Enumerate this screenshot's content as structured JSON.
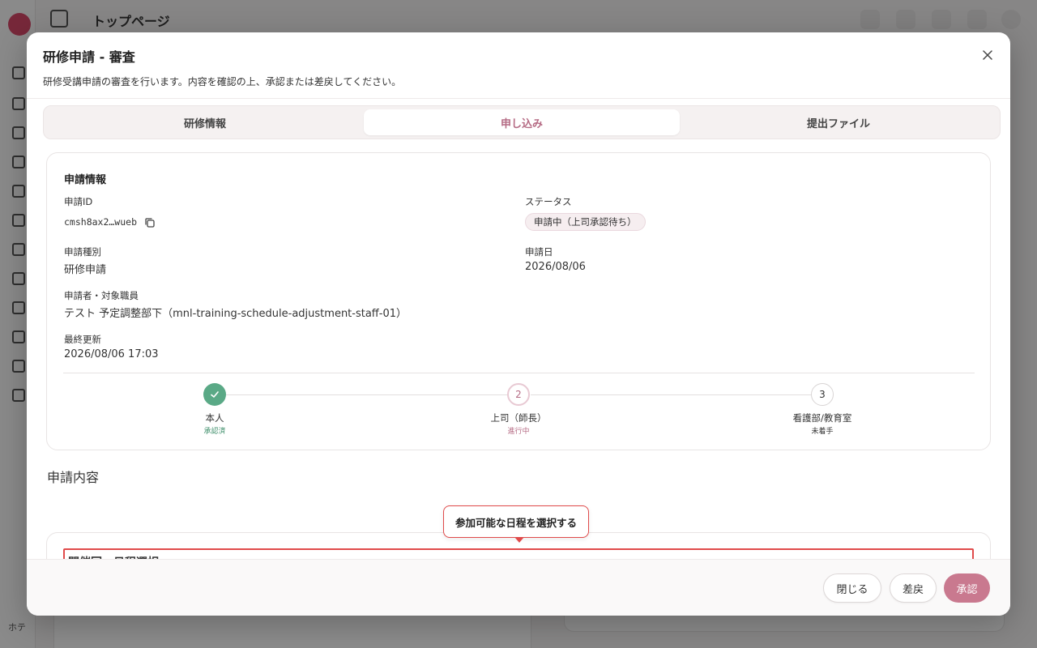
{
  "background": {
    "page_title": "トップページ",
    "user_label": "ホテ"
  },
  "modal": {
    "title": "研修申請 - 審査",
    "description": "研修受講申請の審査を行います。内容を確認の上、承認または差戻してください。",
    "close_icon": "close-icon",
    "tabs": [
      {
        "label": "研修情報",
        "active": false
      },
      {
        "label": "申し込み",
        "active": true
      },
      {
        "label": "提出ファイル",
        "active": false
      }
    ]
  },
  "application_info": {
    "heading": "申請情報",
    "id_label": "申請ID",
    "id_value": "cmsh8ax2…wueb",
    "status_label": "ステータス",
    "status_value": "申請中（上司承認待ち）",
    "type_label": "申請種別",
    "type_value": "研修申請",
    "date_label": "申請日",
    "date_value": "2026/08/06",
    "applicant_label": "申請者・対象職員",
    "applicant_value": "テスト 予定調整部下（mnl-training-schedule-adjustment-staff-01）",
    "updated_label": "最終更新",
    "updated_value": "2026/08/06 17:03"
  },
  "steps": [
    {
      "number": "✓",
      "label": "本人",
      "status": "承認済",
      "state": "done"
    },
    {
      "number": "2",
      "label": "上司（師長）",
      "status": "進行中",
      "state": "active"
    },
    {
      "number": "3",
      "label": "看護部/教育室",
      "status": "未着手",
      "state": "pending"
    }
  ],
  "content": {
    "section_title": "申請内容",
    "schedule_heading": "開催回・日程選択",
    "tooltip": "参加可能な日程を選択する"
  },
  "footer": {
    "close_label": "閉じる",
    "return_label": "差戻",
    "approve_label": "承認"
  },
  "colors": {
    "accent": "#b56b84",
    "approve": "#c9798f",
    "done": "#5aa986",
    "highlight": "#e04a4a"
  }
}
